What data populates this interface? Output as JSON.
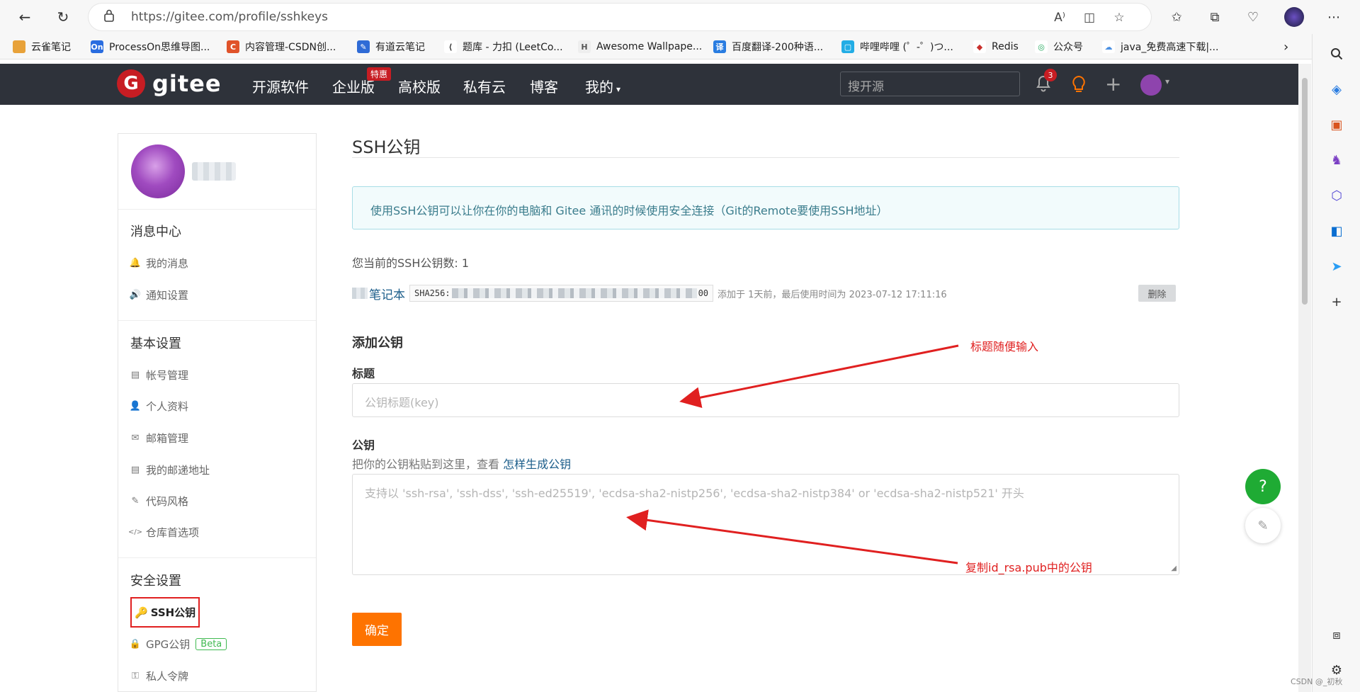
{
  "browser": {
    "url": "https://gitee.com/profile/sshkeys",
    "bookmarks": [
      {
        "label": "云雀笔记",
        "color": "#e8a23a",
        "icon": "folder-icon"
      },
      {
        "label": "ProcessOn思维导图...",
        "color": "#2a6de0",
        "icon": "processon-icon",
        "glyph": "On"
      },
      {
        "label": "内容管理-CSDN创...",
        "color": "#e0532a",
        "icon": "csdn-icon",
        "glyph": "C"
      },
      {
        "label": "有道云笔记",
        "color": "#2f6bd6",
        "icon": "youdao-icon",
        "glyph": "✎"
      },
      {
        "label": "题库 - 力扣 (LeetCo...",
        "color": "#333333",
        "icon": "leetcode-icon",
        "glyph": "⟨"
      },
      {
        "label": "Awesome Wallpape...",
        "color": "#777777",
        "icon": "wallpaper-icon",
        "glyph": "H"
      },
      {
        "label": "百度翻译-200种语...",
        "color": "#2a7de1",
        "icon": "fanyi-icon",
        "glyph": "译"
      },
      {
        "label": "哔哩哔哩 (゜-゜)つ...",
        "color": "#23ade5",
        "icon": "bilibili-icon",
        "glyph": "▢"
      },
      {
        "label": "Redis",
        "color": "#c9302c",
        "icon": "redis-icon",
        "glyph": "◆"
      },
      {
        "label": "公众号",
        "color": "#21a85b",
        "icon": "wechat-icon",
        "glyph": "◎"
      },
      {
        "label": "java_免费高速下载|...",
        "color": "#4a90e2",
        "icon": "download-icon",
        "glyph": "☁"
      }
    ]
  },
  "header": {
    "logo_text": "gitee",
    "nav": [
      "开源软件",
      "企业版",
      "高校版",
      "私有云",
      "博客",
      "我的"
    ],
    "special_badge": "特惠",
    "search_placeholder": "搜开源",
    "notif_count": "3"
  },
  "sidebar": {
    "sections": [
      {
        "title": "消息中心",
        "items": [
          {
            "label": "我的消息",
            "icon": "bell-icon",
            "glyph": "🔔"
          },
          {
            "label": "通知设置",
            "icon": "speaker-icon",
            "glyph": "🔊"
          }
        ]
      },
      {
        "title": "基本设置",
        "items": [
          {
            "label": "帐号管理",
            "icon": "id-card-icon",
            "glyph": "▤"
          },
          {
            "label": "个人资料",
            "icon": "user-icon",
            "glyph": "👤"
          },
          {
            "label": "邮箱管理",
            "icon": "mail-icon",
            "glyph": "✉"
          },
          {
            "label": "我的邮递地址",
            "icon": "address-card-icon",
            "glyph": "▤"
          },
          {
            "label": "代码风格",
            "icon": "brush-icon",
            "glyph": "✎"
          },
          {
            "label": "仓库首选项",
            "icon": "code-icon",
            "glyph": "</>"
          }
        ]
      },
      {
        "title": "安全设置",
        "items": []
      }
    ],
    "active_item": "SSH公钥",
    "gpg_label": "GPG公钥",
    "gpg_badge": "Beta",
    "token_label": "私人令牌"
  },
  "main": {
    "title": "SSH公钥",
    "info": "使用SSH公钥可以让你在你的电脑和 Gitee 通讯的时候使用安全连接（Git的Remote要使用SSH地址）",
    "count_text": "您当前的SSH公钥数: 1",
    "key": {
      "name": "笔记本",
      "sha_prefix": "SHA256:",
      "sha_suffix": "00",
      "meta": "添加于 1天前，最后使用时间为 2023-07-12 17:11:16",
      "delete_label": "删除"
    },
    "add_heading": "添加公钥",
    "title_label": "标题",
    "title_placeholder": "公钥标题(key)",
    "pubkey_label": "公钥",
    "hint_text": "把你的公钥粘贴到这里，查看 ",
    "hint_link": "怎样生成公钥",
    "pubkey_placeholder": "支持以 'ssh-rsa', 'ssh-dss', 'ssh-ed25519', 'ecdsa-sha2-nistp256', 'ecdsa-sha2-nistp384' or 'ecdsa-sha2-nistp521' 开头",
    "submit_label": "确定"
  },
  "annotations": {
    "title_note": "标题随便输入",
    "pubkey_note": "复制id_rsa.pub中的公钥",
    "color": "#e02020"
  },
  "watermark": "CSDN @_初秋"
}
